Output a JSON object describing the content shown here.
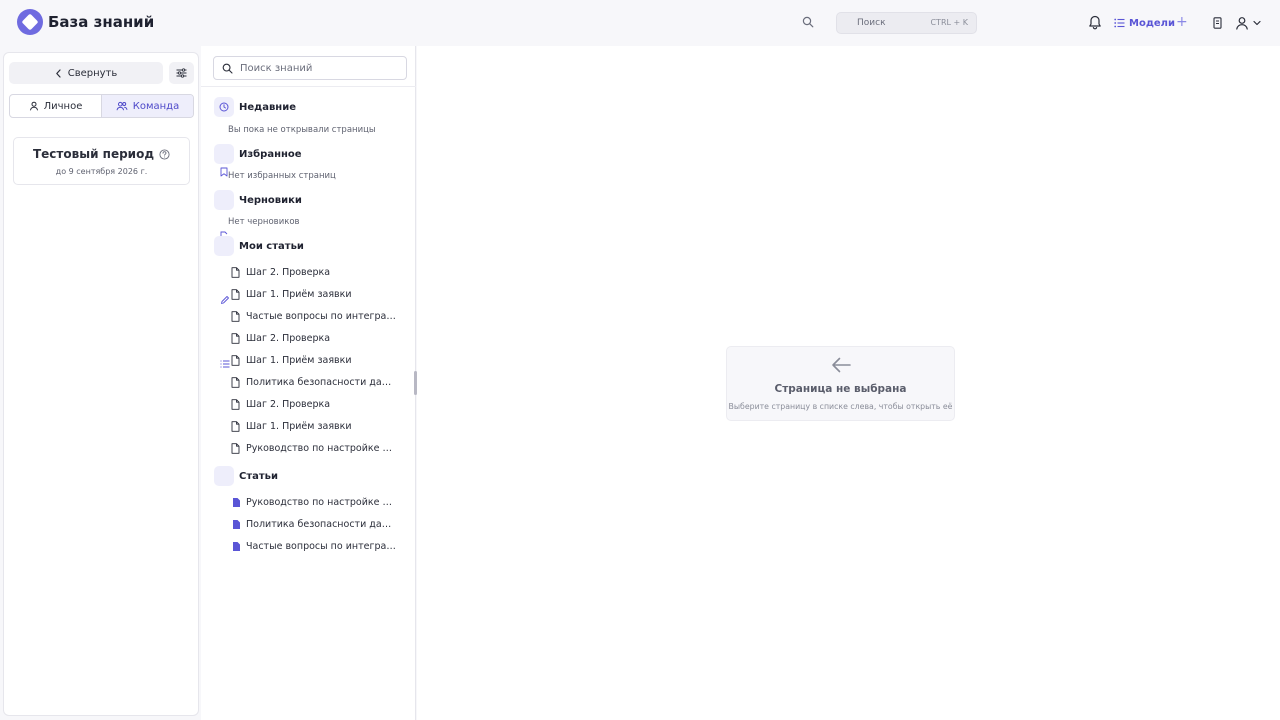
{
  "header": {
    "app_title": "База знаний",
    "search_placeholder": "Поиск",
    "search_shortcut": "CTRL + K",
    "models_label": "Модели",
    "plus_label": "+"
  },
  "sidebar": {
    "collapse_label": "Свернуть",
    "tabs": [
      {
        "label": "Личное",
        "active": false
      },
      {
        "label": "Команда",
        "active": true
      }
    ],
    "trial": {
      "title": "Тестовый период",
      "subtitle": "до 9 сентября 2026 г."
    }
  },
  "knowledge": {
    "search_placeholder": "Поиск знаний",
    "recent": {
      "label": "Недавние",
      "empty": "Вы пока не открывали страницы"
    },
    "favorites": {
      "label": "Избранное",
      "empty": "Нет избранных страниц"
    },
    "drafts": {
      "label": "Черновики",
      "empty": "Нет черновиков"
    },
    "my_articles": {
      "label": "Мои статьи",
      "items": [
        "Шаг 2. Проверка",
        "Шаг 1. Приём заявки",
        "Частые вопросы по интеграции",
        "Шаг 2. Проверка",
        "Шаг 1. Приём заявки",
        "Политика безопасности данн...",
        "Шаг 2. Проверка",
        "Шаг 1. Приём заявки",
        "Руководство по настройке ВР..."
      ]
    },
    "articles": {
      "label": "Статьи",
      "items": [
        "Руководство по настройке В...",
        "Политика безопасности данн...",
        "Частые вопросы по интеграц..."
      ]
    }
  },
  "main": {
    "empty_title": "Страница не выбрана",
    "empty_subtitle": "Выберите страницу в списке слева, чтобы открыть её"
  },
  "colors": {
    "accent": "#5a55d6",
    "accent_light": "#eeeefb",
    "logo": "#6f6be0"
  }
}
